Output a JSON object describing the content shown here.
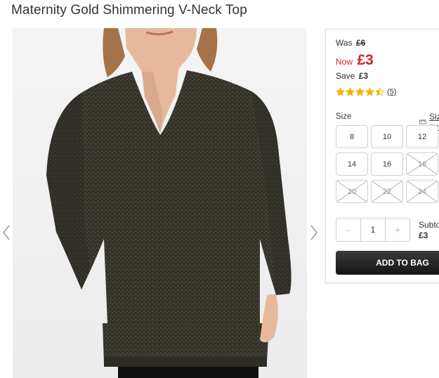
{
  "product": {
    "title": "Maternity Gold Shimmering V-Neck Top"
  },
  "gallery": {
    "prev_icon": "chevron-left-icon",
    "next_icon": "chevron-right-icon"
  },
  "pricing": {
    "was_label": "Was",
    "was_price": "£6",
    "now_label": "Now",
    "now_price": "£3",
    "save_label": "Save",
    "save_price": "£3",
    "now_color": "#d2232a"
  },
  "rating": {
    "stars": 4.5,
    "max": 5,
    "review_count": "(5)",
    "star_color": "#f5b400"
  },
  "size": {
    "label": "Size",
    "guide_label": "Size guide",
    "guide_icon": "ruler-icon",
    "options": [
      {
        "label": "8",
        "available": true
      },
      {
        "label": "10",
        "available": true
      },
      {
        "label": "12",
        "available": true
      },
      {
        "label": "14",
        "available": true
      },
      {
        "label": "16",
        "available": true
      },
      {
        "label": "18",
        "available": false
      },
      {
        "label": "20",
        "available": false
      },
      {
        "label": "22",
        "available": false
      },
      {
        "label": "24",
        "available": false
      }
    ]
  },
  "quantity": {
    "minus": "-",
    "value": "1",
    "plus": "+"
  },
  "subtotal": {
    "label": "Subtotal",
    "value": "£3"
  },
  "cta": {
    "add_to_bag": "ADD TO BAG"
  }
}
